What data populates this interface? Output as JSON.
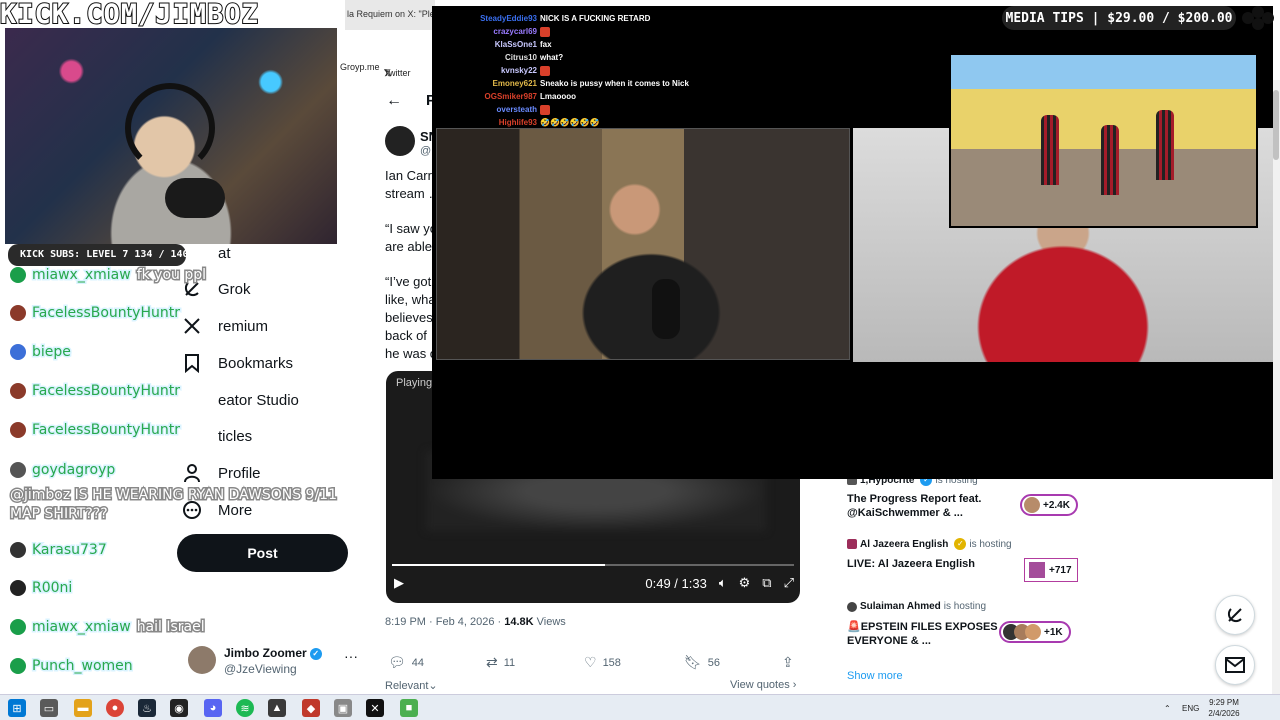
{
  "banner": {
    "text": "KICK.COM/JIMBOZ"
  },
  "browser": {
    "tab_title": "la Requiem on X: \"Ple",
    "bookmarks": [
      "Groyp.me",
      "Twitter"
    ]
  },
  "webcam": {
    "subs": "KICK SUBS: LEVEL 7 134 / 140"
  },
  "x_nav": {
    "items": [
      {
        "label": "at",
        "icon": "chat-icon"
      },
      {
        "label": "Grok",
        "icon": "grok-icon"
      },
      {
        "label": "remium",
        "icon": "x-logo-icon"
      },
      {
        "label": "Bookmarks",
        "icon": "bookmark-icon"
      },
      {
        "label": "eator Studio",
        "icon": "creator-studio-icon"
      },
      {
        "label": "ticles",
        "icon": "articles-icon"
      },
      {
        "label": "Profile",
        "icon": "profile-icon"
      },
      {
        "label": "More",
        "icon": "more-icon"
      }
    ],
    "post_button": "Post",
    "account": {
      "name": "Jimbo Zoomer",
      "handle": "@JzeViewing"
    }
  },
  "chat": [
    {
      "user": "miawx_xmiaw",
      "msg": "fk you ppl",
      "badge_color": "#1a9e4a"
    },
    {
      "user": "FacelessBountyHuntr",
      "msg": "",
      "badge_color": "#8b3a2a"
    },
    {
      "user": "biepe",
      "msg": "",
      "badge_color": "#3c6fd8"
    },
    {
      "user": "FacelessBountyHuntr",
      "msg": "",
      "badge_color": "#8b3a2a"
    },
    {
      "user": "FacelessBountyHuntr",
      "msg": "",
      "badge_color": "#8b3a2a"
    },
    {
      "user": "goydagroyp",
      "msg": "",
      "badge_color": "#555555"
    },
    {
      "user": "Karasu737",
      "msg": "",
      "badge_color": "#333333"
    },
    {
      "user": "R00ni",
      "msg": "",
      "badge_color": "#222222"
    },
    {
      "user": "miawx_xmiaw",
      "msg": "hail Israel",
      "badge_color": "#1a9e4a"
    },
    {
      "user": "Punch_women",
      "msg": "",
      "badge_color": "#1a9e4a"
    }
  ],
  "chat_multiline": "@jimboz IS HE WEARING RYAN DAWSONS 9/11 MAP SHIRT???",
  "tweet": {
    "header_letter": "P",
    "author_short": "SN",
    "handle_short": "@",
    "lines": [
      "Ian Carre",
      "stream …",
      "“I saw yo",
      "are able",
      "“I’ve got",
      "like, wha",
      "believes",
      "back of",
      "he was o"
    ],
    "video": {
      "status": "Playing",
      "time": "0:49 / 1:33",
      "progress": 0.53
    },
    "timestamp": "8:19 PM · Feb 4, 2026 ·",
    "views_count": "14.8K",
    "views_label": "Views",
    "actions": {
      "replies": "44",
      "reposts": "11",
      "likes": "158",
      "bookmarks": "56"
    },
    "relevant": "Relevant",
    "view_quotes": "View quotes"
  },
  "twitch_chat": [
    {
      "user": "SteadyEddie93",
      "msg": "NICK IS A FUCKING RETARD",
      "color": "#3a6ff0"
    },
    {
      "user": "crazycarl69",
      "msg": "",
      "color": "#9a7bff",
      "emote": true
    },
    {
      "user": "KlaSsOne1",
      "msg": "fax",
      "color": "#c9c9ff"
    },
    {
      "user": "Citrus10",
      "msg": "what?",
      "color": "#e0e0e0"
    },
    {
      "user": "kvnsky22",
      "msg": "",
      "color": "#c9c9ff",
      "emote": true
    },
    {
      "user": "Emoney621",
      "msg": "Sneako is pussy when it comes to Nick",
      "color": "#e2b94a"
    },
    {
      "user": "OGSmiker987",
      "msg": "Lmaoooo",
      "color": "#d9402a"
    },
    {
      "user": "oversteath",
      "msg": "",
      "color": "#6a8bff",
      "emote": true
    },
    {
      "user": "Highlife93",
      "msg": "🤣🤣🤣🤣🤣🤣",
      "color": "#d9402a"
    }
  ],
  "media_tips": "MEDIA TIPS | $29.00 / $200.00",
  "media_tips_progress": 0.145,
  "rail": [
    {
      "host": "1,Hypocrite",
      "suffix": "is hosting",
      "title": "The Progress Report feat. @KaiSchwemmer & ...",
      "count": "+2.4K"
    },
    {
      "host": "Al Jazeera English",
      "suffix": "is hosting",
      "title": "LIVE: Al Jazeera English",
      "count": "+717"
    },
    {
      "host": "Sulaiman Ahmed",
      "suffix": "is hosting",
      "title": "🚨EPSTEIN FILES EXPOSES EVERYONE & ...",
      "count": "+1K"
    }
  ],
  "rail_show_more": "Show more",
  "taskbar": {
    "lang": "ENG",
    "time": "9:29 PM",
    "date": "2/4/2026"
  }
}
